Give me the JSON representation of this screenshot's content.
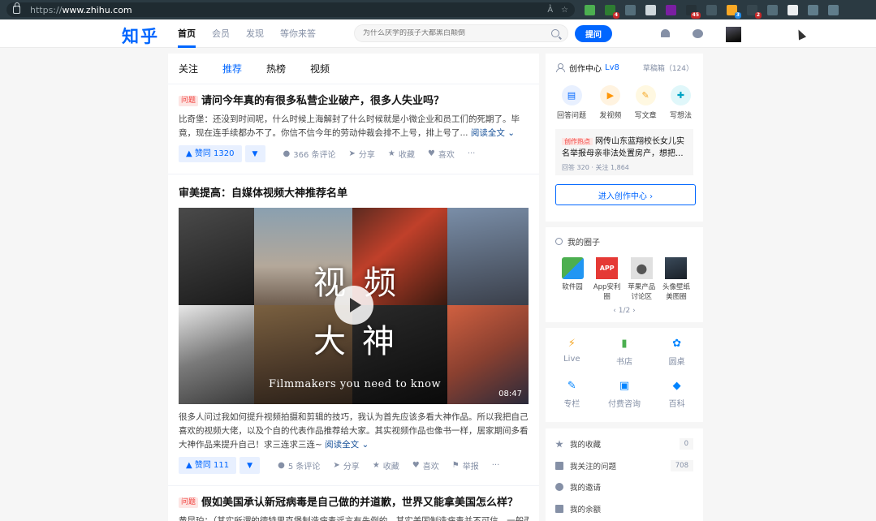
{
  "browser": {
    "url_protocol": "https://",
    "url_host": "www.zhihu.com",
    "ext_badges": [
      "4",
      "45",
      "3",
      "2"
    ]
  },
  "header": {
    "logo": "知乎",
    "nav": [
      "首页",
      "会员",
      "发现",
      "等你来答"
    ],
    "search_placeholder": "为什么厌学的孩子大都黑白颠倒",
    "ask_label": "提问"
  },
  "colors": {
    "brand": "#0066ff",
    "tag_red": "#f1403c"
  },
  "feed": {
    "tabs": [
      "关注",
      "推荐",
      "热榜",
      "视频"
    ],
    "items": [
      {
        "tag": "问题",
        "title": "请问今年真的有很多私营企业破产，很多人失业吗？",
        "excerpt": "比奇堡：还没到时间呢，什么时候上海解封了什么时候就是小微企业和员工们的死期了。毕竟，现在连手续都办不了。你信不信今年的劳动仲裁会排不上号，排上号了...",
        "read_more": "阅读全文",
        "vote_up": "▲ 赞同 1320",
        "comments": "366 条评论",
        "share": "分享",
        "favorite": "收藏",
        "like": "喜欢",
        "more": "···"
      },
      {
        "title": "审美提高：自媒体视频大神推荐名单",
        "video": {
          "char1": "视",
          "char2": "频",
          "char3": "大",
          "char4": "神",
          "subtitle": "Filmmakers you need to know",
          "duration": "08:47"
        },
        "excerpt": "很多人问过我如何提升视频拍摄和剪辑的技巧，我认为首先应该多看大神作品。所以我把自己喜欢的视频大佬，以及个自的代表作品推荐给大家。其实视频作品也像书一样，居家期间多看大神作品来提升自己！求三连求三连~",
        "read_more": "阅读全文",
        "vote_up": "▲ 赞同 111",
        "comments": "5 条评论",
        "share": "分享",
        "favorite": "收藏",
        "like": "喜欢",
        "report": "举报",
        "more": "···"
      },
      {
        "tag": "问题",
        "title": "假如美国承认新冠病毒是自己做的并道歉，世界又能拿美国怎么样？",
        "excerpt": "黄昆珀：（其实所谓的德特里克堡制造病毒谣言有先例的，其实美国制造病毒并不可信，一般而"
      }
    ]
  },
  "creator": {
    "title": "创作中心",
    "level": "Lv8",
    "drafts": "草稿箱（124）",
    "actions": [
      {
        "label": "回答问题",
        "icon": "document-icon"
      },
      {
        "label": "发视频",
        "icon": "video-icon"
      },
      {
        "label": "写文章",
        "icon": "pen-icon"
      },
      {
        "label": "写想法",
        "icon": "idea-icon"
      }
    ],
    "hot_tag": "创作热点",
    "hot_text": "网传山东蓝翔校长女儿实名举报母亲非法处置房产，想把...",
    "hot_meta": "回答 320 · 关注 1,864",
    "enter_label": "进入创作中心 ›"
  },
  "circles": {
    "title": "我的圈子",
    "items": [
      "软件园",
      "App安利圈",
      "苹果产品讨论区",
      "头像壁纸美图圈"
    ],
    "app_logo": "APP",
    "pager": "‹  1/2  ›"
  },
  "shortcuts": [
    {
      "label": "Live",
      "icon": "lightning-icon"
    },
    {
      "label": "书店",
      "icon": "book-icon"
    },
    {
      "label": "圆桌",
      "icon": "roundtable-icon"
    },
    {
      "label": "专栏",
      "icon": "pencil-icon"
    },
    {
      "label": "付费咨询",
      "icon": "consult-icon"
    },
    {
      "label": "百科",
      "icon": "wiki-icon"
    }
  ],
  "links": [
    {
      "label": "我的收藏",
      "count": "0"
    },
    {
      "label": "我关注的问题",
      "count": "708"
    },
    {
      "label": "我的邀请",
      "count": ""
    },
    {
      "label": "我的余额",
      "count": ""
    }
  ]
}
